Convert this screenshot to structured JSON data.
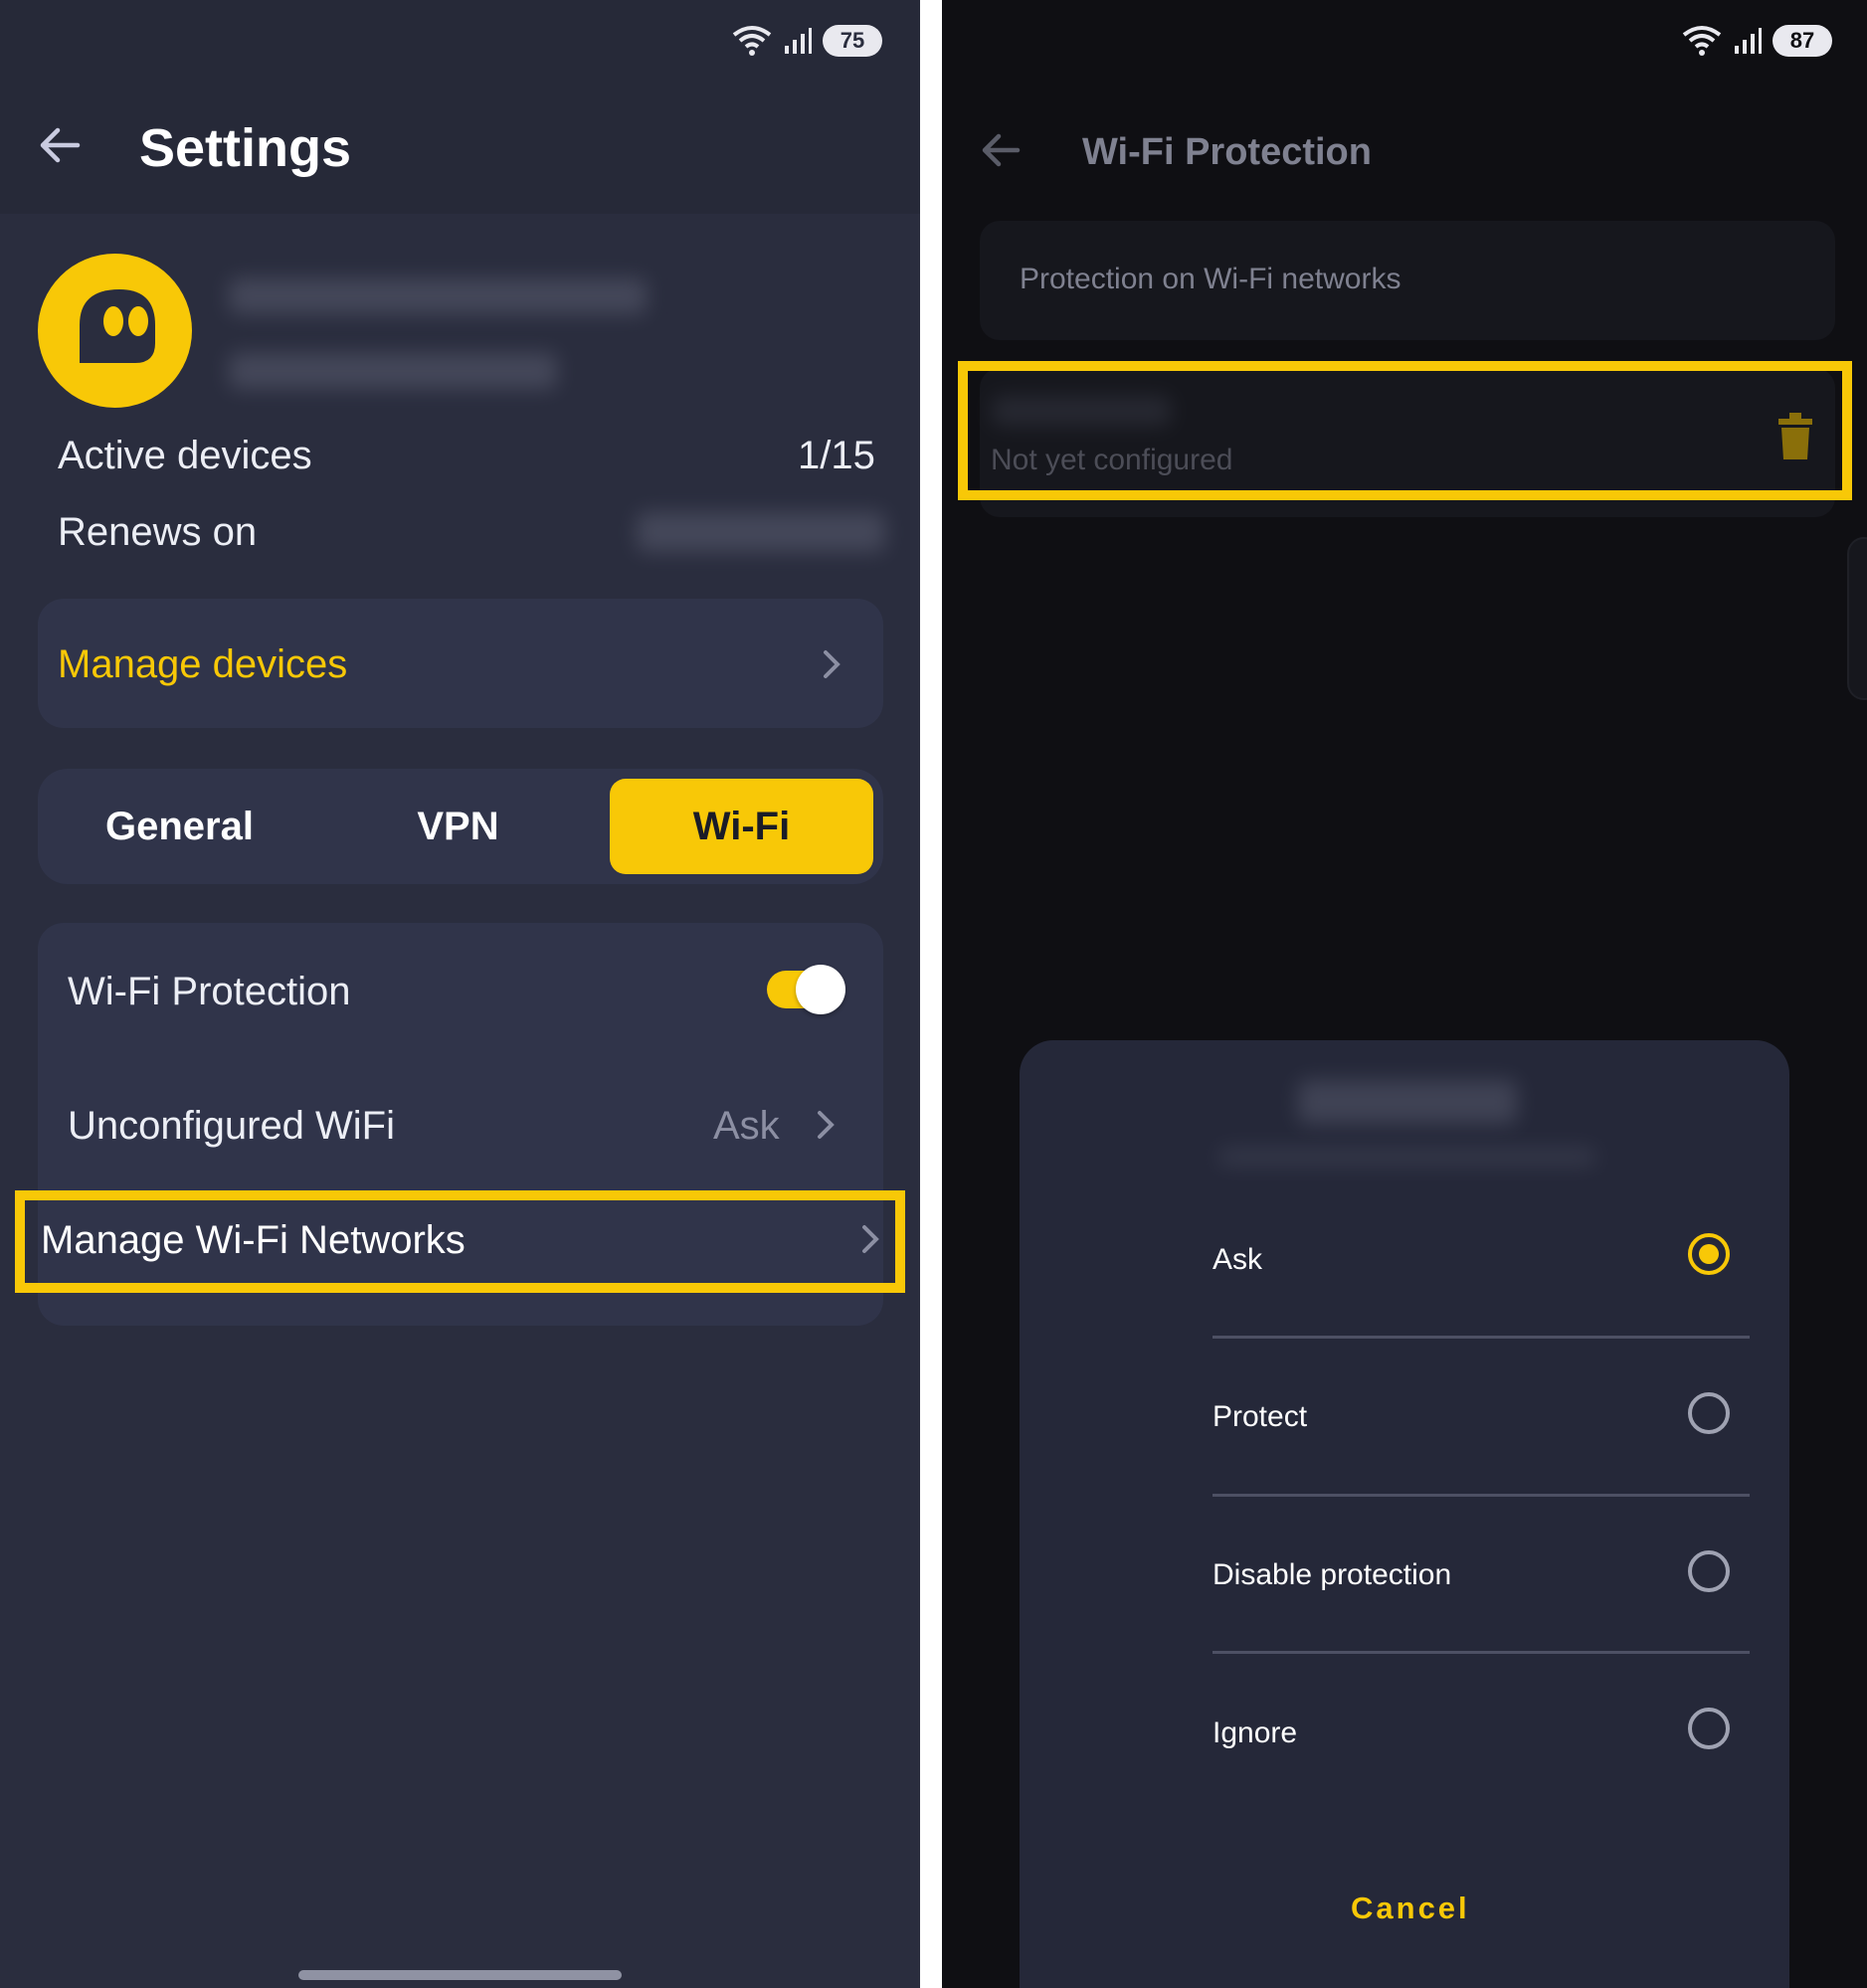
{
  "left": {
    "status": {
      "battery": "75"
    },
    "title": "Settings",
    "account": {
      "active_devices_label": "Active devices",
      "active_devices_value": "1/15",
      "renews_label": "Renews on"
    },
    "manage_devices": "Manage devices",
    "tabs": [
      {
        "label": "General",
        "active": false
      },
      {
        "label": "VPN",
        "active": false
      },
      {
        "label": "Wi-Fi",
        "active": true
      }
    ],
    "wifi_protection_label": "Wi-Fi Protection",
    "wifi_protection_on": true,
    "unconfigured_label": "Unconfigured WiFi",
    "unconfigured_value": "Ask",
    "manage_networks": "Manage Wi-Fi Networks"
  },
  "right": {
    "status": {
      "battery": "87"
    },
    "title": "Wi-Fi Protection",
    "section_header": "Protection on Wi-Fi networks",
    "network_status": "Not yet configured",
    "dialog": {
      "options": [
        {
          "label": "Ask",
          "selected": true
        },
        {
          "label": "Protect",
          "selected": false
        },
        {
          "label": "Disable protection",
          "selected": false
        },
        {
          "label": "Ignore",
          "selected": false
        }
      ],
      "cancel": "Cancel"
    }
  },
  "colors": {
    "accent": "#f8c807",
    "left_bg": "#2a2d3e",
    "right_bg": "#0f0f13",
    "sheet_bg": "#252839"
  }
}
